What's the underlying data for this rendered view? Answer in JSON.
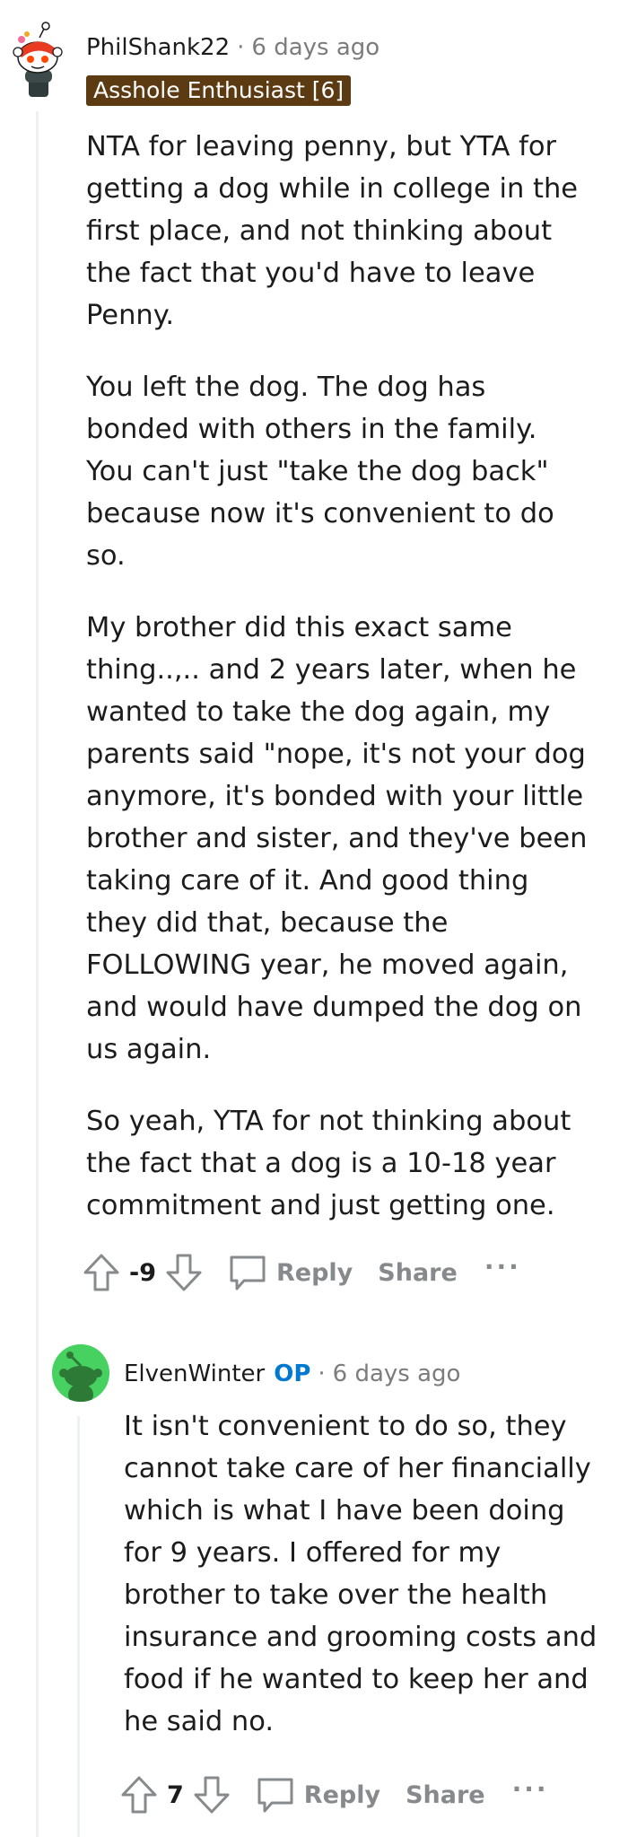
{
  "comments": [
    {
      "author": "PhilShank22",
      "separator": "·",
      "time": "6 days ago",
      "flair": "Asshole Enthusiast [6]",
      "paragraphs": [
        "NTA for leaving penny, but YTA for getting a dog while in college in the first place, and not thinking about the fact that you'd have to leave Penny.",
        "You left the dog. The dog has bonded with others in the family. You can't just \"take the dog back\" because now it's convenient to do so.",
        "My brother did this exact same thing..,.. and 2 years later, when he wanted to take the dog again, my parents said \"nope, it's not your dog anymore, it's bonded with your little brother and sister, and they've been taking care of it. And good thing they did that, because the FOLLOWING year, he moved again, and would have dumped the dog on us again.",
        "So yeah, YTA for not thinking about the fact that a dog is a 10-18 year commitment and just getting one."
      ],
      "score": "-9",
      "reply_label": "Reply",
      "share_label": "Share",
      "more_label": "···"
    },
    {
      "author": "ElvenWinter",
      "op_tag": "OP",
      "separator": "·",
      "time": "6 days ago",
      "paragraphs": [
        "It isn't convenient to do so, they cannot take care of her financially which is what I have been doing for 9 years. I offered for my brother to take over the health insurance and grooming costs and food if he wanted to keep her and he said no."
      ],
      "score": "7",
      "reply_label": "Reply",
      "share_label": "Share",
      "more_label": "···"
    }
  ],
  "colors": {
    "flair_bg": "#5c3a12",
    "op_tag": "#0079d3",
    "meta_text": "#7c7c7c",
    "action_text": "#878a8c",
    "thread_line": "#edeff1",
    "green_avatar": "#46d160"
  },
  "icons": {
    "avatar_1": "snoo-avatar-red-hat-icon",
    "avatar_2": "snoo-avatar-green-icon",
    "upvote": "upvote-arrow-icon",
    "downvote": "downvote-arrow-icon",
    "reply": "comment-bubble-icon"
  }
}
